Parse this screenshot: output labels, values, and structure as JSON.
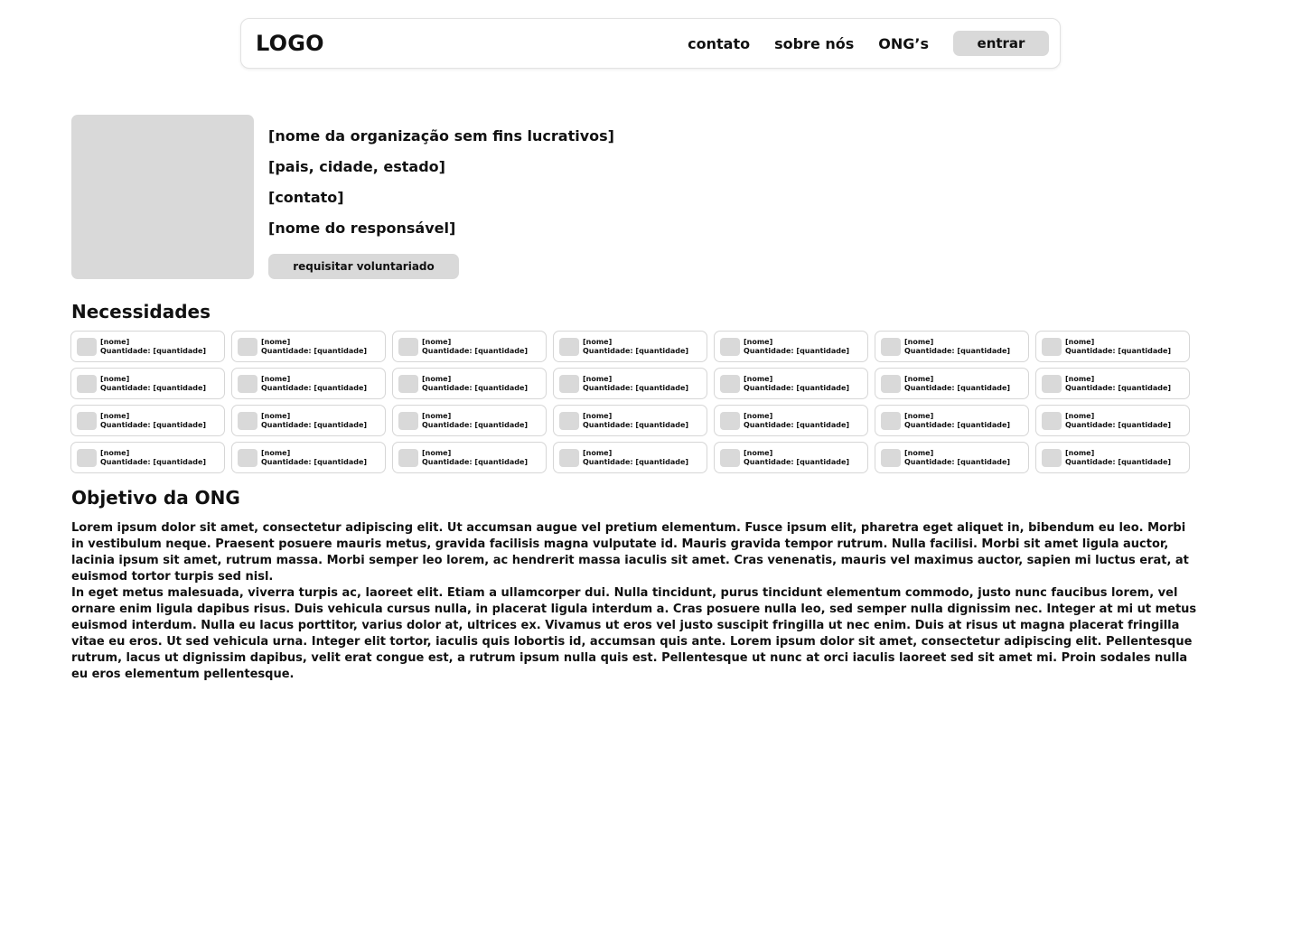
{
  "header": {
    "logo": "LOGO",
    "nav": [
      {
        "label": "contato"
      },
      {
        "label": "sobre nós"
      },
      {
        "label": "ONG’s"
      }
    ],
    "login_label": "entrar"
  },
  "profile": {
    "name": "[nome da organização sem fins lucrativos]",
    "location": "[pais, cidade, estado]",
    "contact": "[contato]",
    "responsible": "[nome do responsável]",
    "request_label": "requisitar voluntariado"
  },
  "needs": {
    "title": "Necessidades",
    "item_name": "[nome]",
    "item_quantity": "Quantidade: [quantidade]",
    "rows": 4,
    "columns": 7
  },
  "objective": {
    "title": "Objetivo da ONG",
    "paragraphs": [
      "Lorem ipsum dolor sit amet, consectetur adipiscing elit. Ut accumsan augue vel pretium elementum. Fusce ipsum elit, pharetra eget aliquet in, bibendum eu leo. Morbi in vestibulum neque. Praesent posuere mauris metus, gravida facilisis magna vulputate id. Mauris gravida tempor rutrum. Nulla facilisi. Morbi sit amet ligula auctor, lacinia ipsum sit amet, rutrum massa. Morbi semper leo lorem, ac hendrerit massa iaculis sit amet. Cras venenatis, mauris vel maximus auctor, sapien mi luctus erat, at euismod tortor turpis sed nisl.",
      "In eget metus malesuada, viverra turpis ac, laoreet elit. Etiam a ullamcorper dui. Nulla tincidunt, purus tincidunt elementum commodo, justo nunc faucibus lorem, vel ornare enim ligula dapibus risus. Duis vehicula cursus nulla, in placerat ligula interdum a. Cras posuere nulla leo, sed semper nulla dignissim nec. Integer at mi ut metus euismod interdum. Nulla eu lacus porttitor, varius dolor at, ultrices ex. Vivamus ut eros vel justo suscipit fringilla ut nec enim. Duis at risus ut magna placerat fringilla vitae eu eros. Ut sed vehicula urna. Integer elit tortor, iaculis quis lobortis id, accumsan quis ante. Lorem ipsum dolor sit amet, consectetur adipiscing elit. Pellentesque rutrum, lacus ut dignissim dapibus, velit erat congue est, a rutrum ipsum nulla quis est. Pellentesque ut nunc at orci iaculis laoreet sed sit amet mi. Proin sodales nulla eu eros elementum pellentesque."
    ]
  }
}
